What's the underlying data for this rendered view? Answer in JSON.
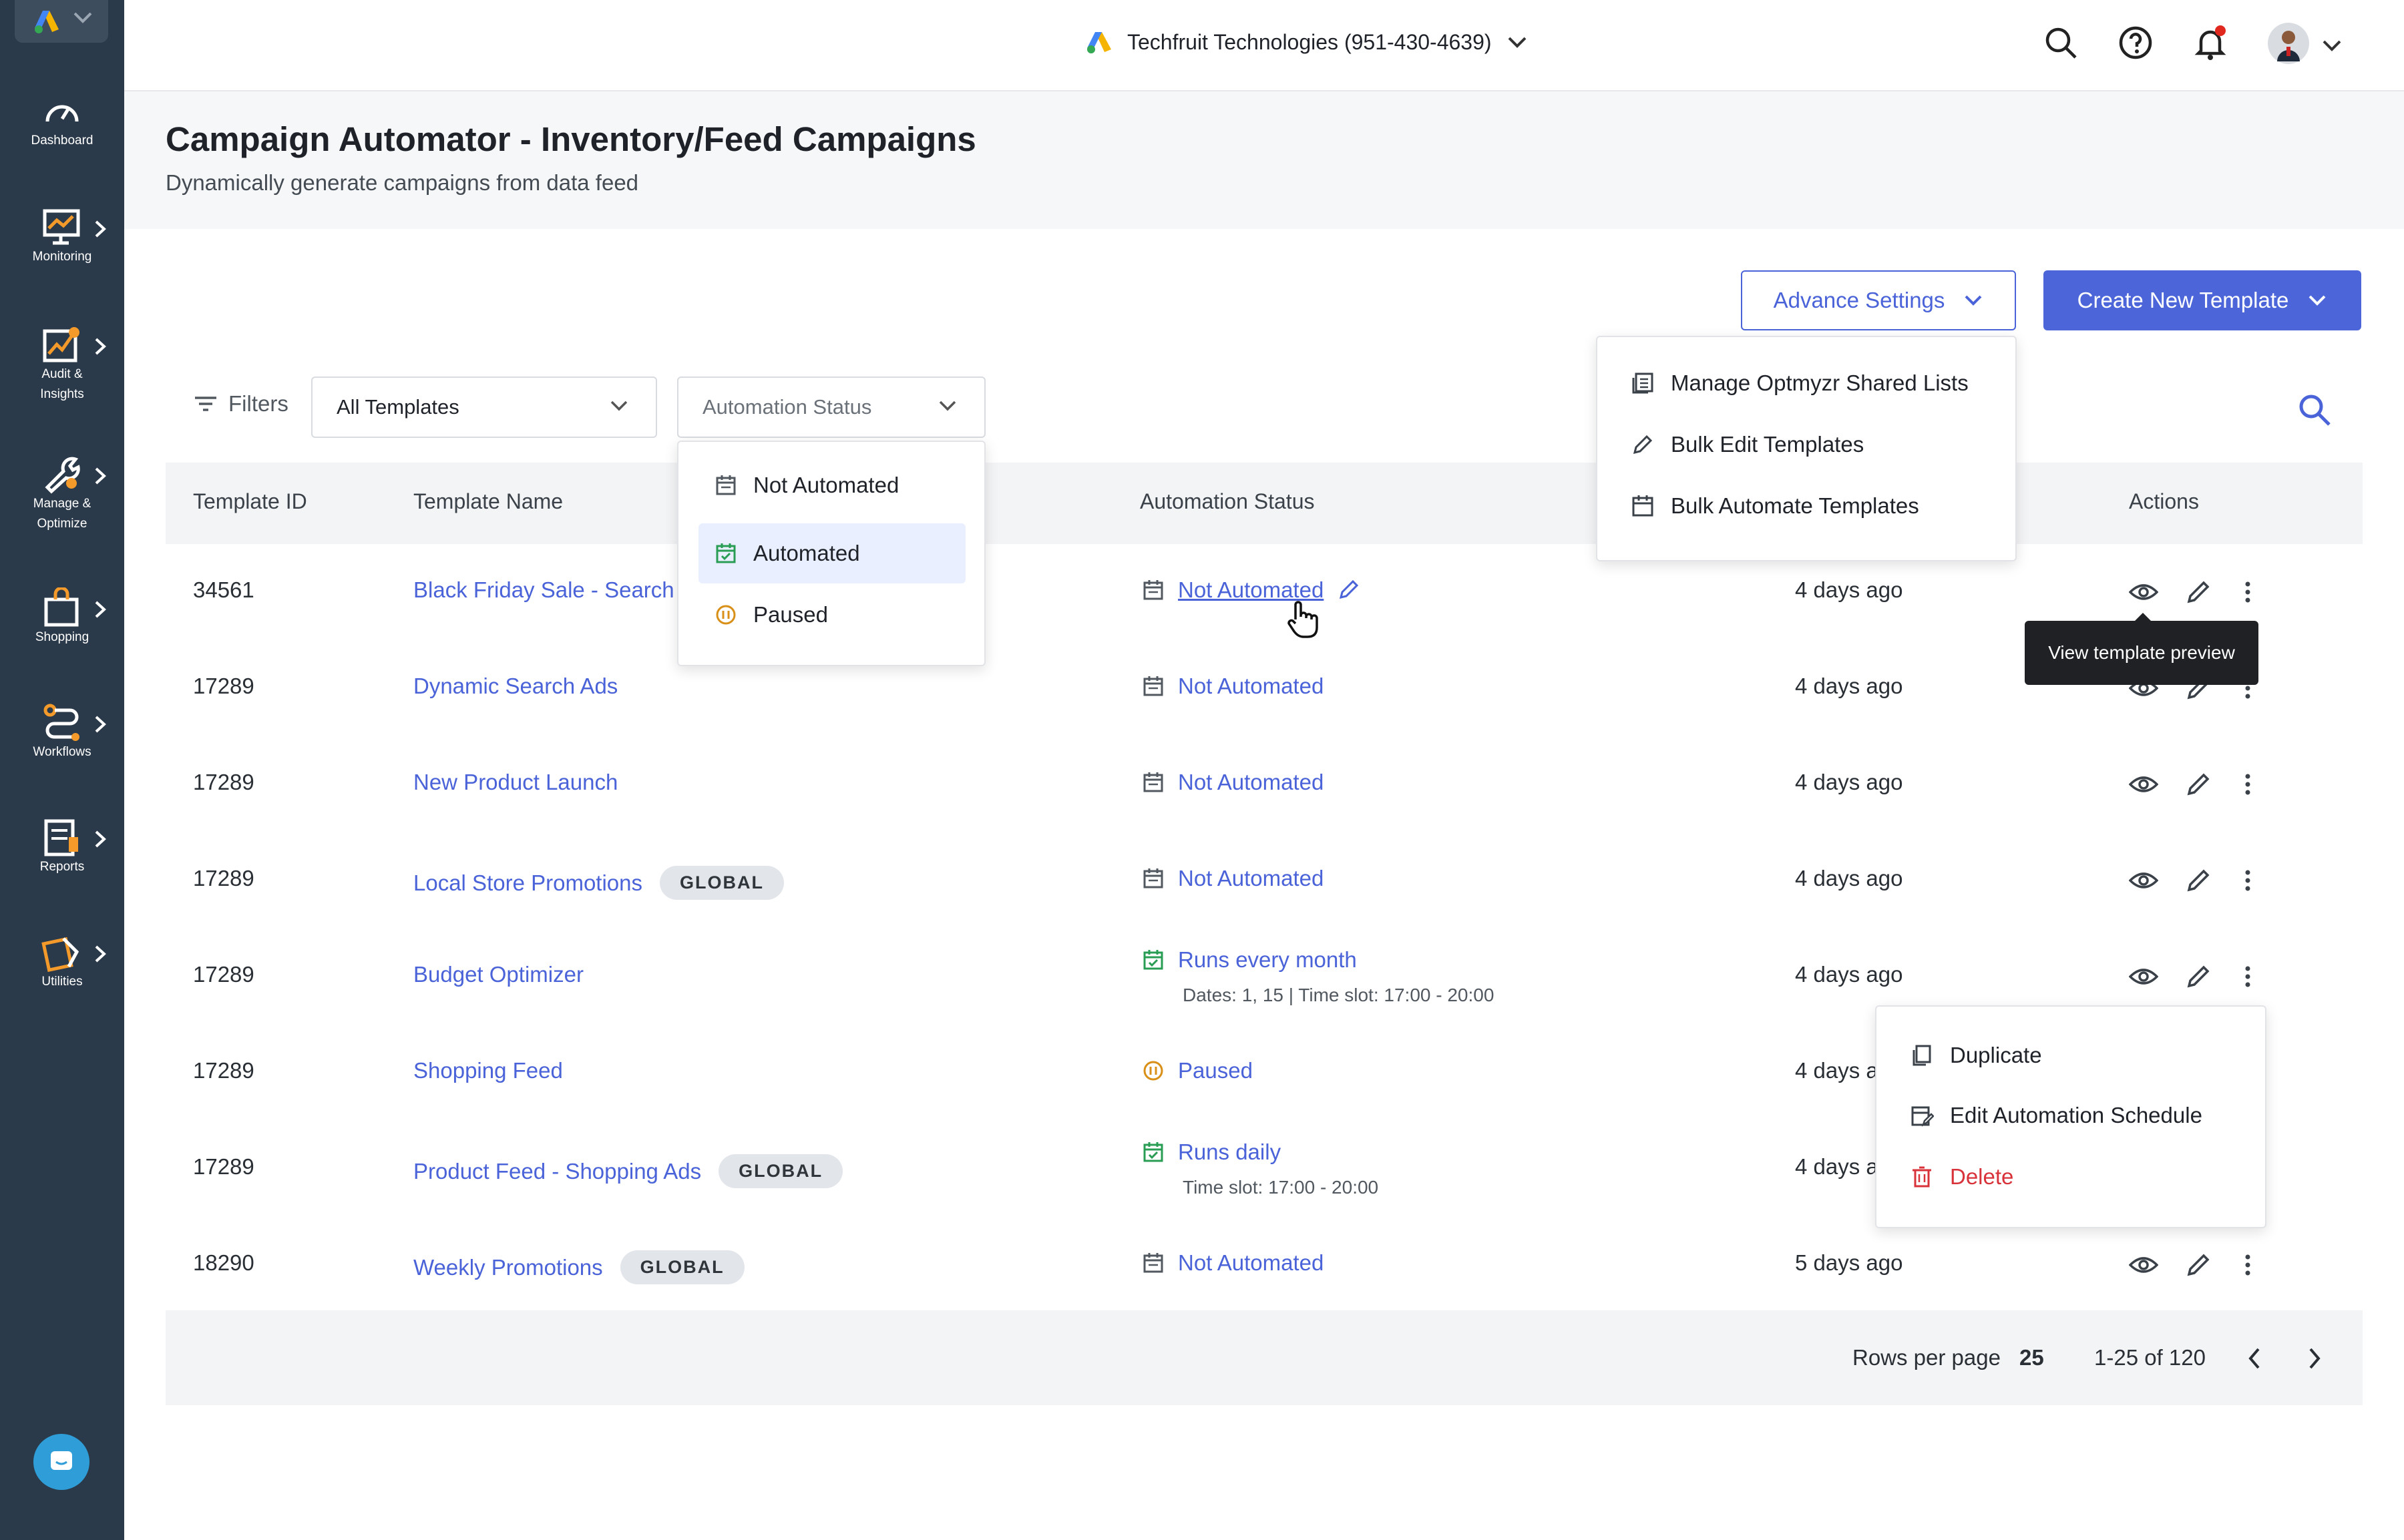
{
  "colors": {
    "accent": "#4a63d8",
    "rail": "#2b3a4a",
    "danger": "#d8323a",
    "success": "#2a9d55",
    "paused": "#d99019"
  },
  "nav": {
    "items": [
      {
        "label": "Dashboard",
        "icon": "gauge-icon"
      },
      {
        "label": "Monitoring",
        "icon": "monitor-chart-icon"
      },
      {
        "label": "Audit &\nInsights",
        "icon": "audit-chart-icon"
      },
      {
        "label": "Manage &\nOptimize",
        "icon": "wrench-icon"
      },
      {
        "label": "Shopping",
        "icon": "shopping-bag-icon"
      },
      {
        "label": "Workflows",
        "icon": "workflow-icon"
      },
      {
        "label": "Reports",
        "icon": "report-icon"
      },
      {
        "label": "Utilities",
        "icon": "utilities-icon"
      }
    ]
  },
  "topbar": {
    "account": "Techfruit Technologies (951-430-4639)"
  },
  "header": {
    "title": "Campaign Automator - Inventory/Feed Campaigns",
    "subtitle": "Dynamically generate campaigns from data feed"
  },
  "toolbar": {
    "advance_settings": "Advance Settings",
    "create_template": "Create New Template"
  },
  "filters": {
    "label": "Filters",
    "templates_value": "All Templates",
    "status_placeholder": "Automation Status"
  },
  "status_dropdown": {
    "options": [
      "Not Automated",
      "Automated",
      "Paused"
    ],
    "highlighted": "Automated"
  },
  "advance_menu": {
    "items": [
      "Manage Optmyzr Shared Lists",
      "Bulk Edit Templates",
      "Bulk Automate Templates"
    ]
  },
  "table": {
    "headers": {
      "id": "Template ID",
      "name": "Template Name",
      "status": "Automation Status",
      "actions": "Actions"
    },
    "rows": [
      {
        "id": "34561",
        "name": "Black Friday Sale - Search",
        "badge": "",
        "status": "Not Automated",
        "status_sub": "",
        "modified": "4 days ago"
      },
      {
        "id": "17289",
        "name": "Dynamic Search Ads",
        "badge": "",
        "status": "Not Automated",
        "status_sub": "",
        "modified": "4 days ago"
      },
      {
        "id": "17289",
        "name": "New Product Launch",
        "badge": "",
        "status": "Not Automated",
        "status_sub": "",
        "modified": "4 days ago"
      },
      {
        "id": "17289",
        "name": "Local Store Promotions",
        "badge": "GLOBAL",
        "status": "Not Automated",
        "status_sub": "",
        "modified": "4 days ago"
      },
      {
        "id": "17289",
        "name": "Budget Optimizer",
        "badge": "",
        "status": "Runs every month",
        "status_sub": "Dates: 1, 15 | Time slot: 17:00 - 20:00",
        "modified": "4 days ago"
      },
      {
        "id": "17289",
        "name": "Shopping Feed",
        "badge": "",
        "status": "Paused",
        "status_sub": "",
        "modified": "4 days a"
      },
      {
        "id": "17289",
        "name": "Product Feed - Shopping Ads",
        "badge": "GLOBAL",
        "status": "Runs daily",
        "status_sub": "Time slot: 17:00 - 20:00",
        "modified": "4 days a"
      },
      {
        "id": "18290",
        "name": "Weekly Promotions",
        "badge": "GLOBAL",
        "status": "Not Automated",
        "status_sub": "",
        "modified": "5 days ago"
      }
    ]
  },
  "tooltip": "View template preview",
  "row_menu": {
    "items": [
      "Duplicate",
      "Edit Automation Schedule",
      "Delete"
    ]
  },
  "pagination": {
    "rows_label": "Rows per page",
    "rows_value": "25",
    "range": "1-25 of 120"
  }
}
